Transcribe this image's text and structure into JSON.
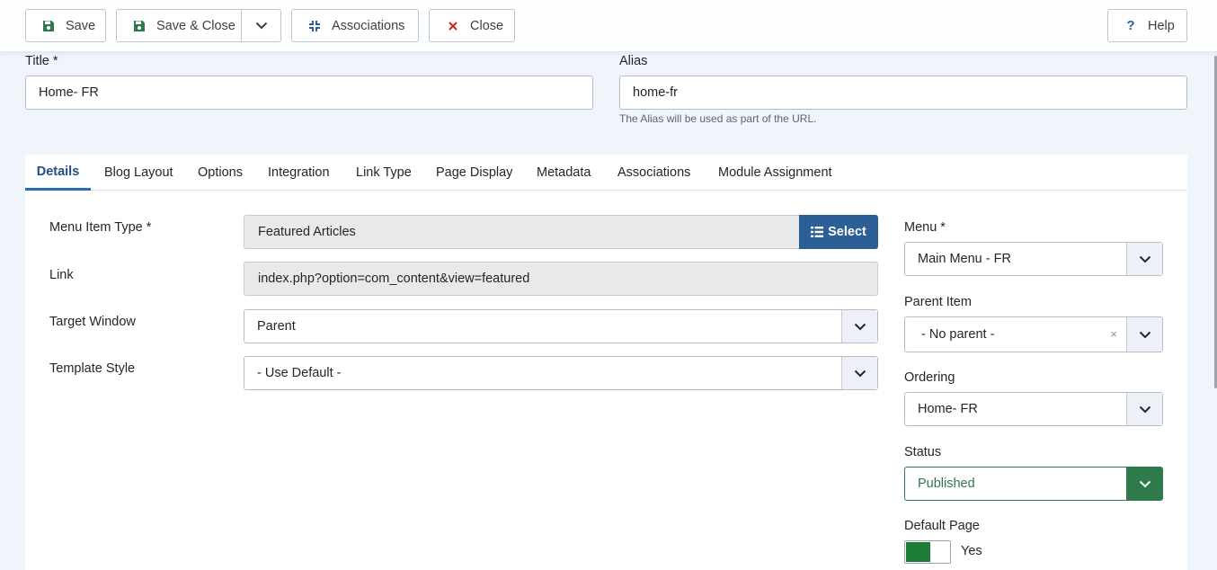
{
  "toolbar": {
    "save": "Save",
    "save_close": "Save & Close",
    "associations": "Associations",
    "close": "Close",
    "help": "Help"
  },
  "title": {
    "label": "Title *",
    "value": "Home- FR"
  },
  "alias": {
    "label": "Alias",
    "value": "home-fr",
    "hint": "The Alias will be used as part of the URL."
  },
  "tabs": [
    "Details",
    "Blog Layout",
    "Options",
    "Integration",
    "Link Type",
    "Page Display",
    "Metadata",
    "Associations",
    "Module Assignment"
  ],
  "details": {
    "menu_item_type": {
      "label": "Menu Item Type *",
      "value": "Featured Articles",
      "button": "Select"
    },
    "link": {
      "label": "Link",
      "value": "index.php?option=com_content&view=featured"
    },
    "target_window": {
      "label": "Target Window",
      "value": "Parent"
    },
    "template_style": {
      "label": "Template Style",
      "value": "- Use Default -"
    }
  },
  "side": {
    "menu": {
      "label": "Menu *",
      "value": "Main Menu - FR"
    },
    "parent_item": {
      "label": "Parent Item",
      "value": "- No parent -",
      "clear": "×"
    },
    "ordering": {
      "label": "Ordering",
      "value": "Home- FR"
    },
    "status": {
      "label": "Status",
      "value": "Published"
    },
    "default_page": {
      "label": "Default Page",
      "value": "Yes"
    }
  },
  "colors": {
    "primary": "#2c5f95",
    "success": "#2e7a4a",
    "danger": "#c52827",
    "toggle_on": "#1c7b34"
  },
  "icons": [
    "save-icon",
    "chevron-down-icon",
    "associations-icon",
    "close-icon",
    "help-icon",
    "list-icon"
  ]
}
